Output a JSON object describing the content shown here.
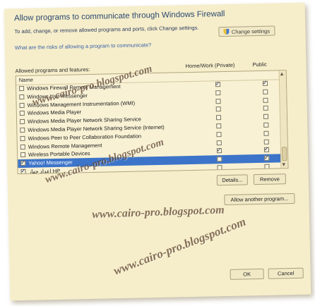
{
  "dialog": {
    "title": "Allow programs to communicate through Windows Firewall",
    "intro": "To add, change, or remove allowed programs and ports, click Change settings.",
    "change_settings_label": "Change settings",
    "risks_link": "What are the risks of allowing a program to communicate?",
    "list_caption": "Allowed programs and features:",
    "columns": {
      "name": "Name",
      "home_work": "Home/Work (Private)",
      "public": "Public"
    },
    "programs": [
      {
        "name": "Windows Firewall Remote Management",
        "enabled": false,
        "home_work": true,
        "public": true
      },
      {
        "name": "Windows Live Messenger",
        "enabled": false,
        "home_work": false,
        "public": false
      },
      {
        "name": "Windows Management Instrumentation (WMI)",
        "enabled": false,
        "home_work": false,
        "public": false
      },
      {
        "name": "Windows Media Player",
        "enabled": false,
        "home_work": false,
        "public": false
      },
      {
        "name": "Windows Media Player Network Sharing Service",
        "enabled": false,
        "home_work": false,
        "public": false
      },
      {
        "name": "Windows Media Player Network Sharing Service (Internet)",
        "enabled": false,
        "home_work": false,
        "public": false
      },
      {
        "name": "Windows Peer to Peer Collaboration Foundation",
        "enabled": false,
        "home_work": false,
        "public": false
      },
      {
        "name": "Windows Remote Management",
        "enabled": false,
        "home_work": false,
        "public": false
      },
      {
        "name": "Wireless Portable Devices",
        "enabled": false,
        "home_work": true,
        "public": true
      },
      {
        "name": "Yahoo! Messenger",
        "enabled": true,
        "home_work": false,
        "public": true,
        "selected": true
      },
      {
        "name": "إعداد جهاز HP",
        "enabled": true,
        "home_work": false,
        "public": false
      }
    ],
    "details_label": "Details...",
    "remove_label": "Remove",
    "allow_another_label": "Allow another program...",
    "ok_label": "OK",
    "cancel_label": "Cancel"
  },
  "watermarks": [
    "www.cairo-pro.blogspot.com",
    "www.cairo-pro.blogspot.com",
    "www.cairo-pro.blogspot.com",
    "www.cairo-pro.blogspot.com"
  ],
  "colors": {
    "window_bg": "#f6eeca",
    "selection": "#3c74c9",
    "title_text": "#2a4770",
    "link": "#3a62a8"
  }
}
